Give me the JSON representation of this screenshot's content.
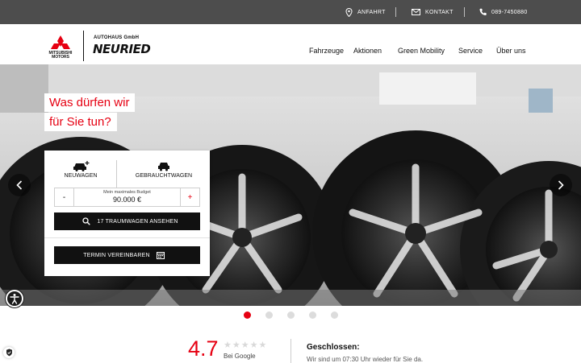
{
  "topbar": {
    "directions": "ANFAHRT",
    "contact": "KONTAKT",
    "phone": "089-7450880"
  },
  "brand": {
    "maker_line1": "MITSUBISHI",
    "maker_line2": "MOTORS",
    "dealer_small": "AUTOHAUS GmbH",
    "dealer_name": "NEURIED"
  },
  "nav": {
    "items": [
      {
        "label": "Fahrzeuge"
      },
      {
        "label": "Aktionen"
      },
      {
        "label": "Green Mobility"
      },
      {
        "label": "Service"
      },
      {
        "label": "Über uns"
      }
    ]
  },
  "hero": {
    "headline_line1": "Was dürfen wir",
    "headline_line2": "für Sie tun?",
    "slides_total": 5,
    "active_slide": 1
  },
  "finder": {
    "tab_new": "NEUWAGEN",
    "tab_used": "GEBRAUCHTWAGEN",
    "budget_label": "Mein maximales Budget",
    "budget_value": "90.000 €",
    "minus": "-",
    "plus": "+",
    "search_button": "17 TRAUMWAGEN ANSEHEN",
    "appointment_button": "TERMIN VEREINBAREN"
  },
  "reviews": {
    "score": "4.7",
    "stars": "★★★★★",
    "source": "Bei Google"
  },
  "hours": {
    "status": "Geschlossen:",
    "message": "Wir sind um 07:30 Uhr wieder für Sie da."
  },
  "colors": {
    "accent": "#e60012",
    "topbar": "#4d4d4d",
    "button": "#111111"
  }
}
